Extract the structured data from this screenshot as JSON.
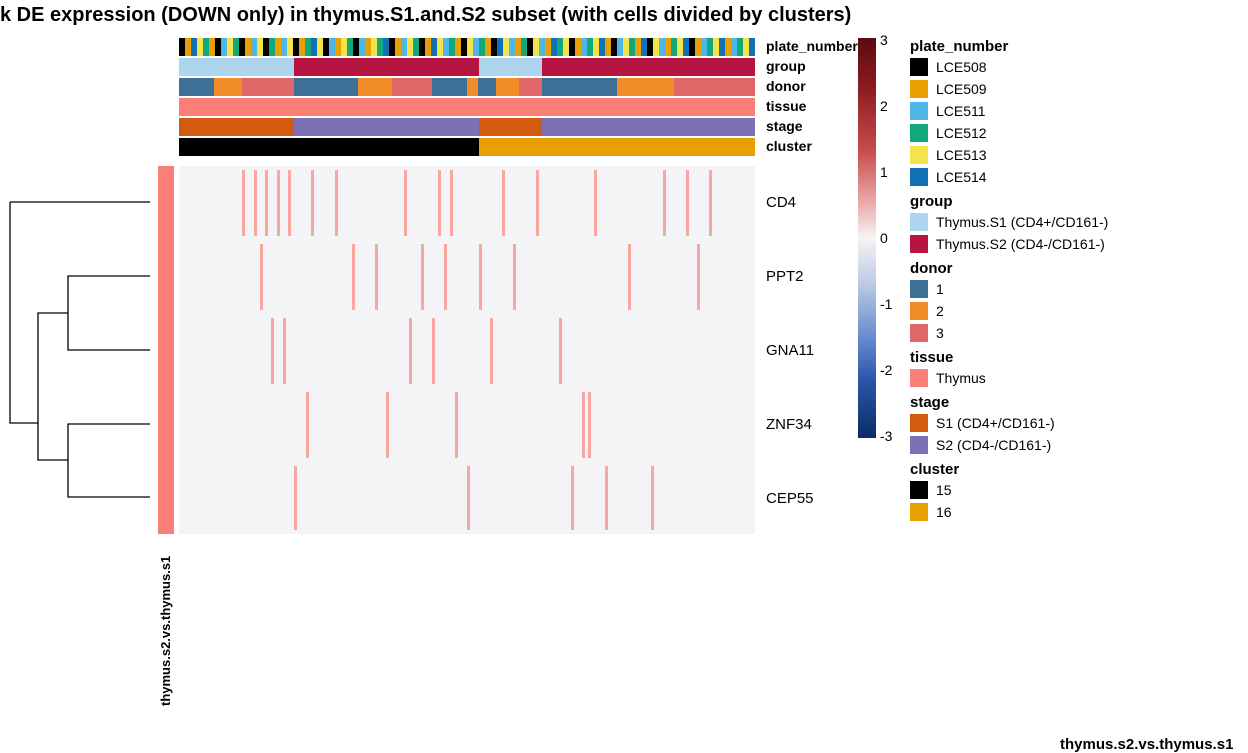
{
  "title": "k DE expression (DOWN only) in thymus.S1.and.S2 subset (with cells divided by clusters)",
  "row_annotation_label": "thymus.s2.vs.thymus.s1",
  "column_annotations": [
    "plate_number",
    "group",
    "donor",
    "tissue",
    "stage",
    "cluster"
  ],
  "genes": [
    "CD4",
    "PPT2",
    "GNA11",
    "ZNF34",
    "CEP55"
  ],
  "colorbar_ticks": [
    "3",
    "2",
    "1",
    "0",
    "-1",
    "-2",
    "-3"
  ],
  "bottom_cut_label": "thymus.s2.vs.thymus.s1",
  "legend": {
    "plate_number": {
      "title": "plate_number",
      "items": [
        {
          "label": "LCE508",
          "color": "#000000"
        },
        {
          "label": "LCE509",
          "color": "#e7a000"
        },
        {
          "label": "LCE511",
          "color": "#4fb6e8"
        },
        {
          "label": "LCE512",
          "color": "#12a77c"
        },
        {
          "label": "LCE513",
          "color": "#f4e34a"
        },
        {
          "label": "LCE514",
          "color": "#1271b5"
        }
      ]
    },
    "group": {
      "title": "group",
      "items": [
        {
          "label": "Thymus.S1 (CD4+/CD161-)",
          "color": "#add6ee"
        },
        {
          "label": "Thymus.S2 (CD4-/CD161-)",
          "color": "#b61441"
        }
      ]
    },
    "donor": {
      "title": "donor",
      "items": [
        {
          "label": "1",
          "color": "#3e6f97"
        },
        {
          "label": "2",
          "color": "#f28c28"
        },
        {
          "label": "3",
          "color": "#e06869"
        }
      ]
    },
    "tissue": {
      "title": "tissue",
      "items": [
        {
          "label": "Thymus",
          "color": "#fb7f77"
        }
      ]
    },
    "stage": {
      "title": "stage",
      "items": [
        {
          "label": "S1 (CD4+/CD161-)",
          "color": "#d25b0f"
        },
        {
          "label": "S2 (CD4-/CD161-)",
          "color": "#7d71b6"
        }
      ]
    },
    "cluster": {
      "title": "cluster",
      "items": [
        {
          "label": "15",
          "color": "#000000"
        },
        {
          "label": "16",
          "color": "#e7a000"
        }
      ]
    }
  },
  "chart_data": {
    "type": "heatmap",
    "title": "k DE expression (DOWN only) in thymus.S1.and.S2 subset (with cells divided by clusters)",
    "row_genes": [
      "CD4",
      "PPT2",
      "GNA11",
      "ZNF34",
      "CEP55"
    ],
    "n_columns_approx": 96,
    "color_scale": {
      "min": -3,
      "mid": 0,
      "max": 3,
      "low_color": "#0b2c66",
      "mid_color": "#f6f4f5",
      "high_color": "#5b0b12"
    },
    "column_annotations": {
      "group_segments": [
        {
          "value": "Thymus.S1",
          "width_frac": 0.2
        },
        {
          "value": "Thymus.S2",
          "width_frac": 0.32
        },
        {
          "value": "Thymus.S1",
          "width_frac": 0.11
        },
        {
          "value": "Thymus.S2",
          "width_frac": 0.37
        }
      ],
      "stage_segments": [
        {
          "value": "S1",
          "width_frac": 0.2
        },
        {
          "value": "S2",
          "width_frac": 0.32
        },
        {
          "value": "S1",
          "width_frac": 0.11
        },
        {
          "value": "S2",
          "width_frac": 0.37
        }
      ],
      "cluster_segments": [
        {
          "value": "15",
          "width_frac": 0.52
        },
        {
          "value": "16",
          "width_frac": 0.48
        }
      ],
      "tissue_segments": [
        {
          "value": "Thymus",
          "width_frac": 1.0
        }
      ],
      "donor_segments": [
        {
          "value": "1",
          "width_frac": 0.06
        },
        {
          "value": "2",
          "width_frac": 0.05
        },
        {
          "value": "3",
          "width_frac": 0.09
        },
        {
          "value": "1",
          "width_frac": 0.11
        },
        {
          "value": "2",
          "width_frac": 0.06
        },
        {
          "value": "3",
          "width_frac": 0.07
        },
        {
          "value": "1",
          "width_frac": 0.06
        },
        {
          "value": "2",
          "width_frac": 0.02
        },
        {
          "value": "1",
          "width_frac": 0.03
        },
        {
          "value": "2",
          "width_frac": 0.04
        },
        {
          "value": "3",
          "width_frac": 0.04
        },
        {
          "value": "1",
          "width_frac": 0.13
        },
        {
          "value": "2",
          "width_frac": 0.1
        },
        {
          "value": "3",
          "width_frac": 0.14
        }
      ],
      "plate_number_pattern_note": "finely alternating between LCE508-514; approximated below",
      "plate_number_segments_color": [
        "#000000",
        "#e7a000",
        "#1271b5",
        "#f4e34a",
        "#12a77c",
        "#e7a000",
        "#000000",
        "#4fb6e8",
        "#f4e34a",
        "#12a77c",
        "#000000",
        "#e7a000",
        "#4fb6e8",
        "#f4e34a",
        "#000000",
        "#12a77c",
        "#e7a000",
        "#4fb6e8",
        "#f4e34a",
        "#000000",
        "#e7a000",
        "#12a77c",
        "#1271b5",
        "#f4e34a",
        "#000000",
        "#4fb6e8",
        "#e7a000",
        "#f4e34a",
        "#12a77c",
        "#000000",
        "#4fb6e8",
        "#e7a000",
        "#f4e34a",
        "#12a77c",
        "#1271b5",
        "#000000",
        "#e7a000",
        "#4fb6e8",
        "#f4e34a",
        "#12a77c",
        "#000000",
        "#e7a000",
        "#1271b5",
        "#f4e34a",
        "#4fb6e8",
        "#12a77c",
        "#e7a000",
        "#000000",
        "#f4e34a",
        "#4fb6e8",
        "#12a77c",
        "#e7a000",
        "#000000",
        "#1271b5",
        "#f4e34a",
        "#4fb6e8",
        "#e7a000",
        "#12a77c",
        "#000000",
        "#f4e34a",
        "#4fb6e8",
        "#e7a000",
        "#1271b5",
        "#12a77c",
        "#f4e34a",
        "#000000",
        "#e7a000",
        "#4fb6e8",
        "#12a77c",
        "#f4e34a",
        "#1271b5",
        "#e7a000",
        "#000000",
        "#4fb6e8",
        "#f4e34a",
        "#12a77c",
        "#e7a000",
        "#1271b5",
        "#000000",
        "#f4e34a",
        "#4fb6e8",
        "#e7a000",
        "#12a77c",
        "#f4e34a",
        "#1271b5",
        "#000000",
        "#e7a000",
        "#4fb6e8",
        "#12a77c",
        "#f4e34a",
        "#1271b5",
        "#e7a000",
        "#4fb6e8",
        "#12a77c",
        "#f4e34a",
        "#1271b5"
      ]
    },
    "row_dendrogram": "CD4 vs ((PPT2,GNA11),(ZNF34,CEP55))",
    "sparse_high_cells_approx_pct": {
      "CD4": [
        11,
        13,
        15,
        17,
        19,
        23,
        27,
        39,
        45,
        47,
        56,
        62,
        72,
        84,
        88,
        92
      ],
      "PPT2": [
        14,
        30,
        34,
        42,
        46,
        52,
        58,
        78,
        90
      ],
      "GNA11": [
        16,
        18,
        40,
        44,
        54,
        66
      ],
      "ZNF34": [
        22,
        36,
        48,
        70,
        71
      ],
      "CEP55": [
        20,
        50,
        68,
        74,
        82
      ]
    }
  }
}
